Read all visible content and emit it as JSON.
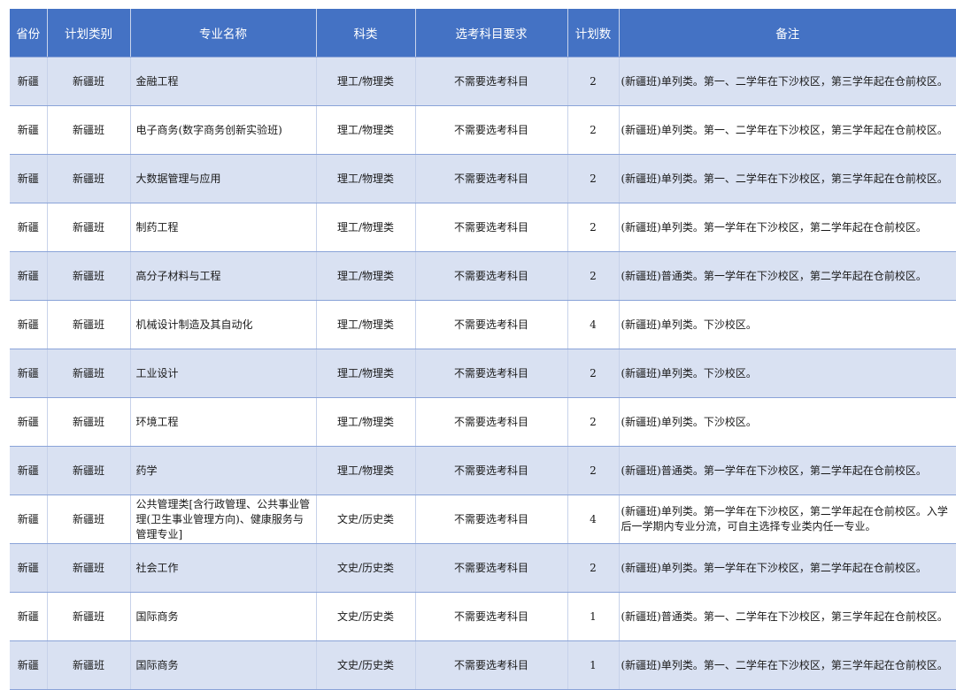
{
  "headers": [
    "省份",
    "计划类别",
    "专业名称",
    "科类",
    "选考科目要求",
    "计划数",
    "备注"
  ],
  "rows": [
    {
      "province": "新疆",
      "category": "新疆班",
      "major": "金融工程",
      "subject": "理工/物理类",
      "requirement": "不需要选考科目",
      "plan": "2",
      "note": "(新疆班)单列类。第一、二学年在下沙校区，第三学年起在仓前校区。"
    },
    {
      "province": "新疆",
      "category": "新疆班",
      "major": "电子商务(数字商务创新实验班)",
      "subject": "理工/物理类",
      "requirement": "不需要选考科目",
      "plan": "2",
      "note": "(新疆班)单列类。第一、二学年在下沙校区，第三学年起在仓前校区。"
    },
    {
      "province": "新疆",
      "category": "新疆班",
      "major": "大数据管理与应用",
      "subject": "理工/物理类",
      "requirement": "不需要选考科目",
      "plan": "2",
      "note": "(新疆班)单列类。第一、二学年在下沙校区，第三学年起在仓前校区。"
    },
    {
      "province": "新疆",
      "category": "新疆班",
      "major": "制药工程",
      "subject": "理工/物理类",
      "requirement": "不需要选考科目",
      "plan": "2",
      "note": "(新疆班)单列类。第一学年在下沙校区，第二学年起在仓前校区。"
    },
    {
      "province": "新疆",
      "category": "新疆班",
      "major": "高分子材料与工程",
      "subject": "理工/物理类",
      "requirement": "不需要选考科目",
      "plan": "2",
      "note": "(新疆班)普通类。第一学年在下沙校区，第二学年起在仓前校区。"
    },
    {
      "province": "新疆",
      "category": "新疆班",
      "major": "机械设计制造及其自动化",
      "subject": "理工/物理类",
      "requirement": "不需要选考科目",
      "plan": "4",
      "note": "(新疆班)单列类。下沙校区。"
    },
    {
      "province": "新疆",
      "category": "新疆班",
      "major": "工业设计",
      "subject": "理工/物理类",
      "requirement": "不需要选考科目",
      "plan": "2",
      "note": "(新疆班)单列类。下沙校区。"
    },
    {
      "province": "新疆",
      "category": "新疆班",
      "major": "环境工程",
      "subject": "理工/物理类",
      "requirement": "不需要选考科目",
      "plan": "2",
      "note": "(新疆班)单列类。下沙校区。"
    },
    {
      "province": "新疆",
      "category": "新疆班",
      "major": "药学",
      "subject": "理工/物理类",
      "requirement": "不需要选考科目",
      "plan": "2",
      "note": "(新疆班)普通类。第一学年在下沙校区，第二学年起在仓前校区。"
    },
    {
      "province": "新疆",
      "category": "新疆班",
      "major": "公共管理类[含行政管理、公共事业管理(卫生事业管理方向)、健康服务与管理专业]",
      "subject": "文史/历史类",
      "requirement": "不需要选考科目",
      "plan": "4",
      "note": "(新疆班)单列类。第一学年在下沙校区，第二学年起在仓前校区。入学后一学期内专业分流，可自主选择专业类内任一专业。"
    },
    {
      "province": "新疆",
      "category": "新疆班",
      "major": "社会工作",
      "subject": "文史/历史类",
      "requirement": "不需要选考科目",
      "plan": "2",
      "note": "(新疆班)单列类。第一学年在下沙校区，第二学年起在仓前校区。"
    },
    {
      "province": "新疆",
      "category": "新疆班",
      "major": "国际商务",
      "subject": "文史/历史类",
      "requirement": "不需要选考科目",
      "plan": "1",
      "note": "(新疆班)普通类。第一、二学年在下沙校区，第三学年起在仓前校区。"
    },
    {
      "province": "新疆",
      "category": "新疆班",
      "major": "国际商务",
      "subject": "文史/历史类",
      "requirement": "不需要选考科目",
      "plan": "1",
      "note": "(新疆班)单列类。第一、二学年在下沙校区，第三学年起在仓前校区。"
    }
  ]
}
